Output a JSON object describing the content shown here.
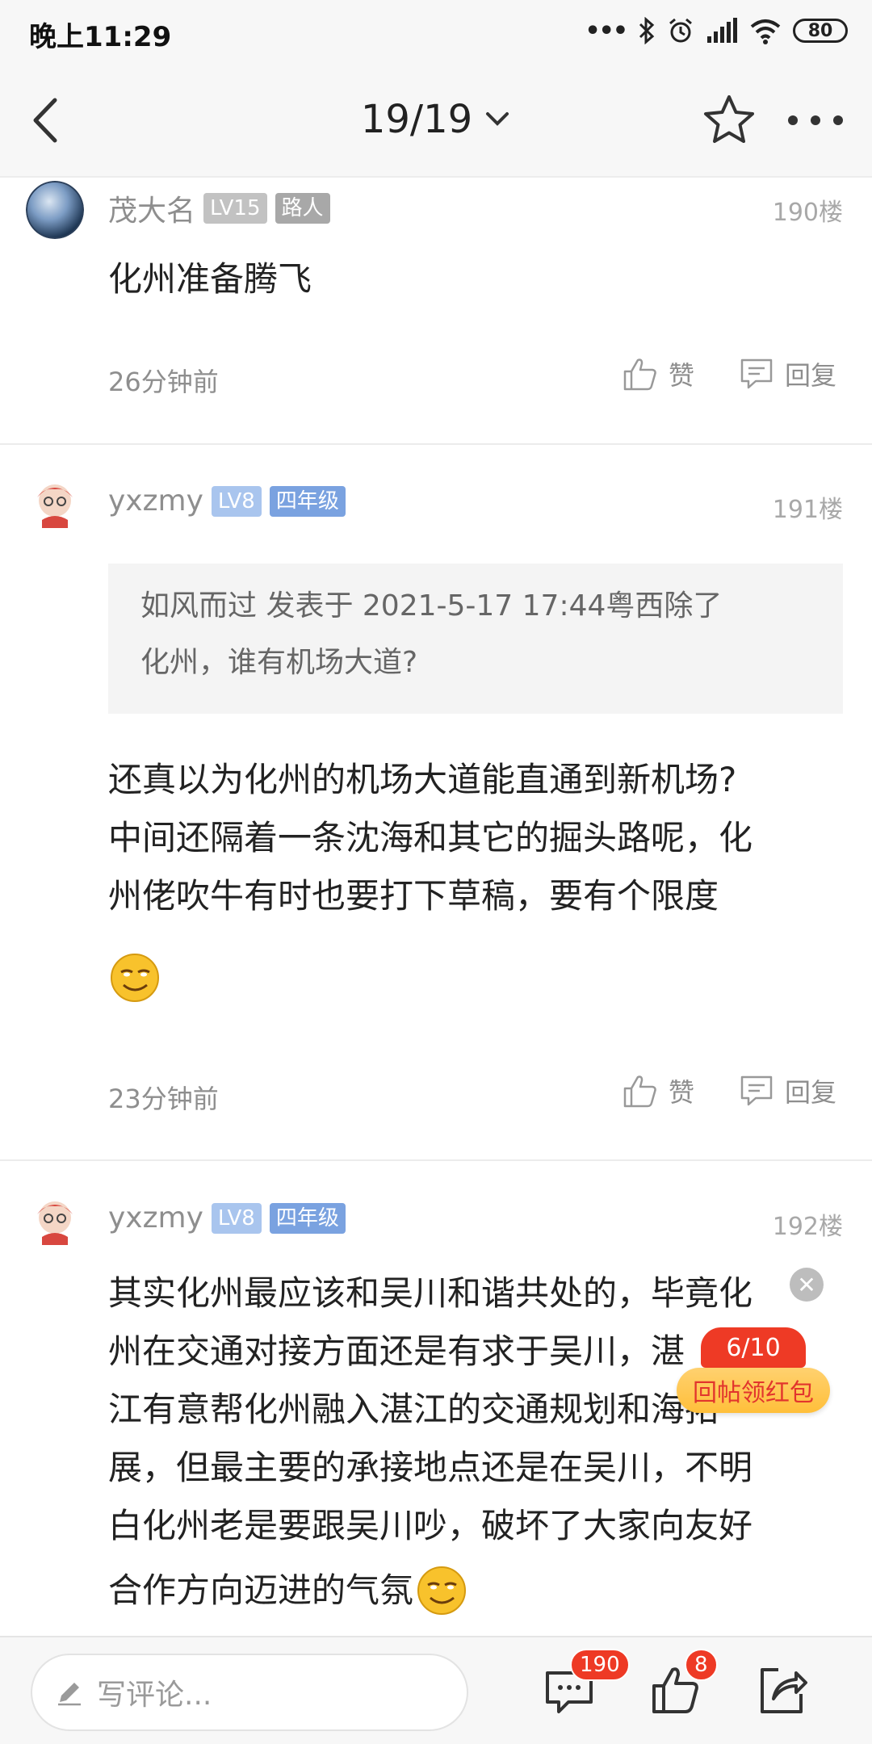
{
  "status_bar": {
    "time": "晚上11:29",
    "battery": "80"
  },
  "header": {
    "page_indicator": "19/19"
  },
  "posts": [
    {
      "username": "茂大名",
      "level": "LV15",
      "rank": "路人",
      "floor": "190楼",
      "content": "化州准备腾飞",
      "time": "26分钟前",
      "like_label": "赞",
      "reply_label": "回复"
    },
    {
      "username": "yxzmy",
      "level": "LV8",
      "rank": "四年级",
      "floor": "191楼",
      "quote_line1": "如风而过 发表于 2021-5-17 17:44粤西除了",
      "quote_line2": "化州，谁有机场大道?",
      "content_line1": "还真以为化州的机场大道能直通到新机场?",
      "content_line2": "中间还隔着一条沈海和其它的掘头路呢，化",
      "content_line3": "州佬吹牛有时也要打下草稿，要有个限度",
      "time": "23分钟前",
      "like_label": "赞",
      "reply_label": "回复"
    },
    {
      "username": "yxzmy",
      "level": "LV8",
      "rank": "四年级",
      "floor": "192楼",
      "content_line1": "其实化州最应该和吴川和谐共处的，毕竟化",
      "content_line2": "州在交通对接方面还是有求于吴川，湛",
      "content_line3": "江有意帮化州融入湛江的交通规划和海拓",
      "content_line4": "展，但最主要的承接地点还是在吴川，不明",
      "content_line5": "白化州老是要跟吴川吵，破坏了大家向友好",
      "content_line6": "合作方向迈进的气氛"
    }
  ],
  "red_packet": {
    "count": "6/10",
    "label": "回帖领红包"
  },
  "bottom_bar": {
    "comment_placeholder": "写评论...",
    "comment_count": "190",
    "like_count": "8"
  },
  "colors": {
    "accent_red": "#ee3a25",
    "badge_blue": "#a9c5ee",
    "text_gray": "#8e8e8e"
  },
  "icons": [
    "back-arrow-icon",
    "chevron-down-icon",
    "star-icon",
    "more-dots-icon",
    "thumbs-up-icon",
    "reply-icon",
    "pencil-icon",
    "comment-icon",
    "share-icon",
    "smile-emoji-icon"
  ]
}
